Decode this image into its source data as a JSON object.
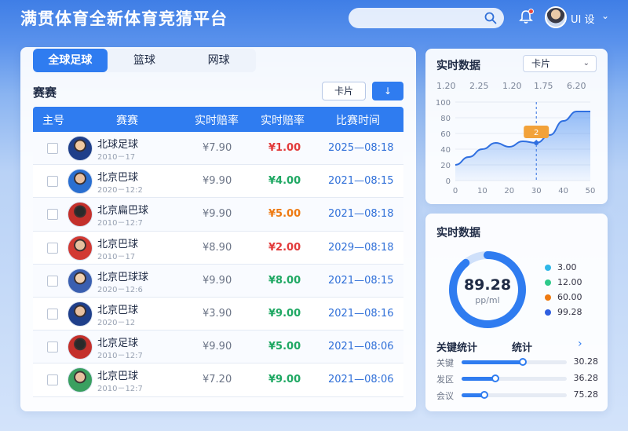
{
  "app": {
    "title": "满贯体育全新体育竞猜平台",
    "user_name": "UI 设"
  },
  "tabs": [
    {
      "label": "全球足球"
    },
    {
      "label": "篮球"
    },
    {
      "label": "网球"
    }
  ],
  "section": {
    "title": "赛赛",
    "card_label": "卡片",
    "sort_icon": "↓"
  },
  "table": {
    "headers": [
      "主号",
      "赛赛",
      "实时赔率",
      "实时赔率",
      "比赛时间"
    ],
    "rows": [
      {
        "name": "北球足球",
        "date": "2010－17",
        "odds": "¥7.90",
        "live": "¥1.00",
        "live_color": "#e23a3a",
        "time": "2025—08:18"
      },
      {
        "name": "北京巴球",
        "date": "2020－12:2",
        "odds": "¥9.90",
        "live": "¥4.00",
        "live_color": "#1fa863",
        "time": "2021—08:15"
      },
      {
        "name": "北京扁巴球",
        "date": "2010－12:7",
        "odds": "¥9.90",
        "live": "¥5.00",
        "live_color": "#ee7a12",
        "time": "2021—08:18"
      },
      {
        "name": "北京巴球",
        "date": "2010－17",
        "odds": "¥8.90",
        "live": "¥2.00",
        "live_color": "#e23a3a",
        "time": "2029—08:18"
      },
      {
        "name": "北京巴球球",
        "date": "2020－12:6",
        "odds": "¥9.90",
        "live": "¥8.00",
        "live_color": "#1fa863",
        "time": "2021—08:15"
      },
      {
        "name": "北京巴球",
        "date": "2020－12",
        "odds": "¥3.90",
        "live": "¥9.00",
        "live_color": "#1fa863",
        "time": "2021—08:16"
      },
      {
        "name": "北京足球",
        "date": "2010－12:7",
        "odds": "¥9.90",
        "live": "¥5.00",
        "live_color": "#1fa863",
        "time": "2021—08:06"
      },
      {
        "name": "北京巴球",
        "date": "2010－12:7",
        "odds": "¥7.20",
        "live": "¥9.00",
        "live_color": "#1fa863",
        "time": "2021—08:06"
      }
    ]
  },
  "chart_panel": {
    "title": "实时数据",
    "select": "卡片",
    "top_labels": [
      "1.20",
      "2.25",
      "1.20",
      "1.75",
      "6.20"
    ],
    "marker_label": "2"
  },
  "chart_data": {
    "type": "area",
    "x": [
      0,
      5,
      10,
      15,
      20,
      25,
      30,
      35,
      40,
      45,
      50
    ],
    "values": [
      20,
      30,
      40,
      48,
      43,
      50,
      48,
      58,
      76,
      88,
      88
    ],
    "xticks": [
      "0",
      "10",
      "20",
      "30",
      "40",
      "50"
    ],
    "yticks": [
      "0",
      "20",
      "40",
      "60",
      "80",
      "100"
    ],
    "xlim": [
      0,
      50
    ],
    "ylim": [
      0,
      100
    ],
    "highlight_x": 30
  },
  "donut_panel": {
    "title": "实时数据",
    "value": "89.28",
    "unit": "pp/ml",
    "progress": 0.89,
    "legend": [
      {
        "label": "3.00",
        "color": "#2fb7e8"
      },
      {
        "label": "12.00",
        "color": "#2ec98a"
      },
      {
        "label": "60.00",
        "color": "#ee7a12"
      },
      {
        "label": "99.28",
        "color": "#2f5fe0"
      }
    ]
  },
  "stats": {
    "title": "关键统计",
    "title2": "统计",
    "items": [
      {
        "label": "关键",
        "value": "30.28",
        "level": 0.58
      },
      {
        "label": "发区",
        "value": "36.28",
        "level": 0.32
      },
      {
        "label": "会议",
        "value": "75.28",
        "level": 0.22
      }
    ]
  }
}
